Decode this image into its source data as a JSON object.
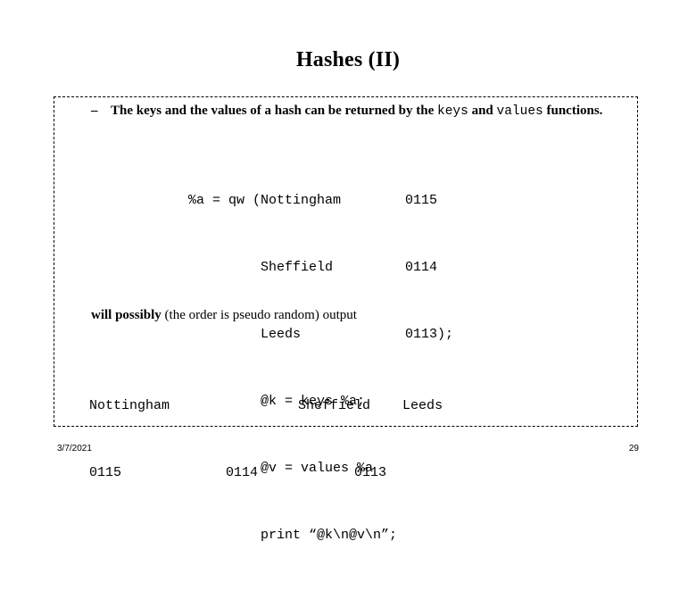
{
  "slide": {
    "title": "Hashes (II)",
    "bullet": {
      "marker": "–",
      "part1": "The keys and the values of a hash can be returned by the ",
      "code1": "keys",
      "part2": " and ",
      "code2": "values",
      "part3": " functions."
    },
    "code_lines": [
      "%a = qw (Nottingham        0115",
      "         Sheffield         0114",
      "         Leeds             0113);",
      "         @k = keys %a;",
      "         @v = values %a",
      "         print “@k\\n@v\\n”;"
    ],
    "note": {
      "bold1": "will possibly",
      "rest": " (the order is pseudo random) output"
    },
    "output_lines": [
      "Nottingham                Sheffield    Leeds",
      "0115             0114            0113"
    ]
  },
  "footer": {
    "date": "3/7/2021",
    "page_number": "29"
  }
}
